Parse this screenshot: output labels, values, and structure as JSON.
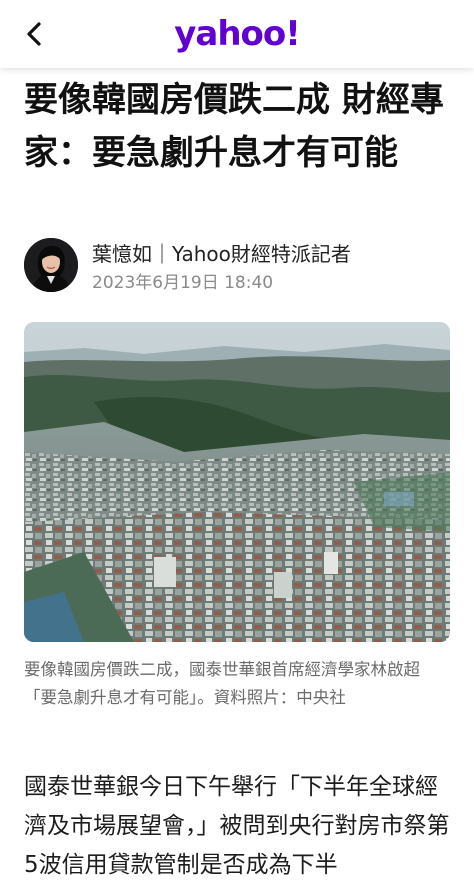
{
  "header": {
    "logo_text": "yahoo!",
    "brand_color": "#6001d2",
    "back_icon": "chevron-left-icon"
  },
  "article": {
    "title": "要像韓國房價跌二成 財經專家：要急劇升息才有可能",
    "author": "葉憶如｜Yahoo財經特派記者",
    "date": "2023年6月19日 18:40",
    "image_caption": "要像韓國房價跌二成，國泰世華銀首席經濟學家林啟超「要急劇升息才有可能」。資料照片：中央社",
    "body_first_paragraph": "國泰世華銀今日下午舉行「下半年全球經濟及市場展望會，」被問到央行對房市祭第5波信用貸款管制是否成為下半"
  }
}
